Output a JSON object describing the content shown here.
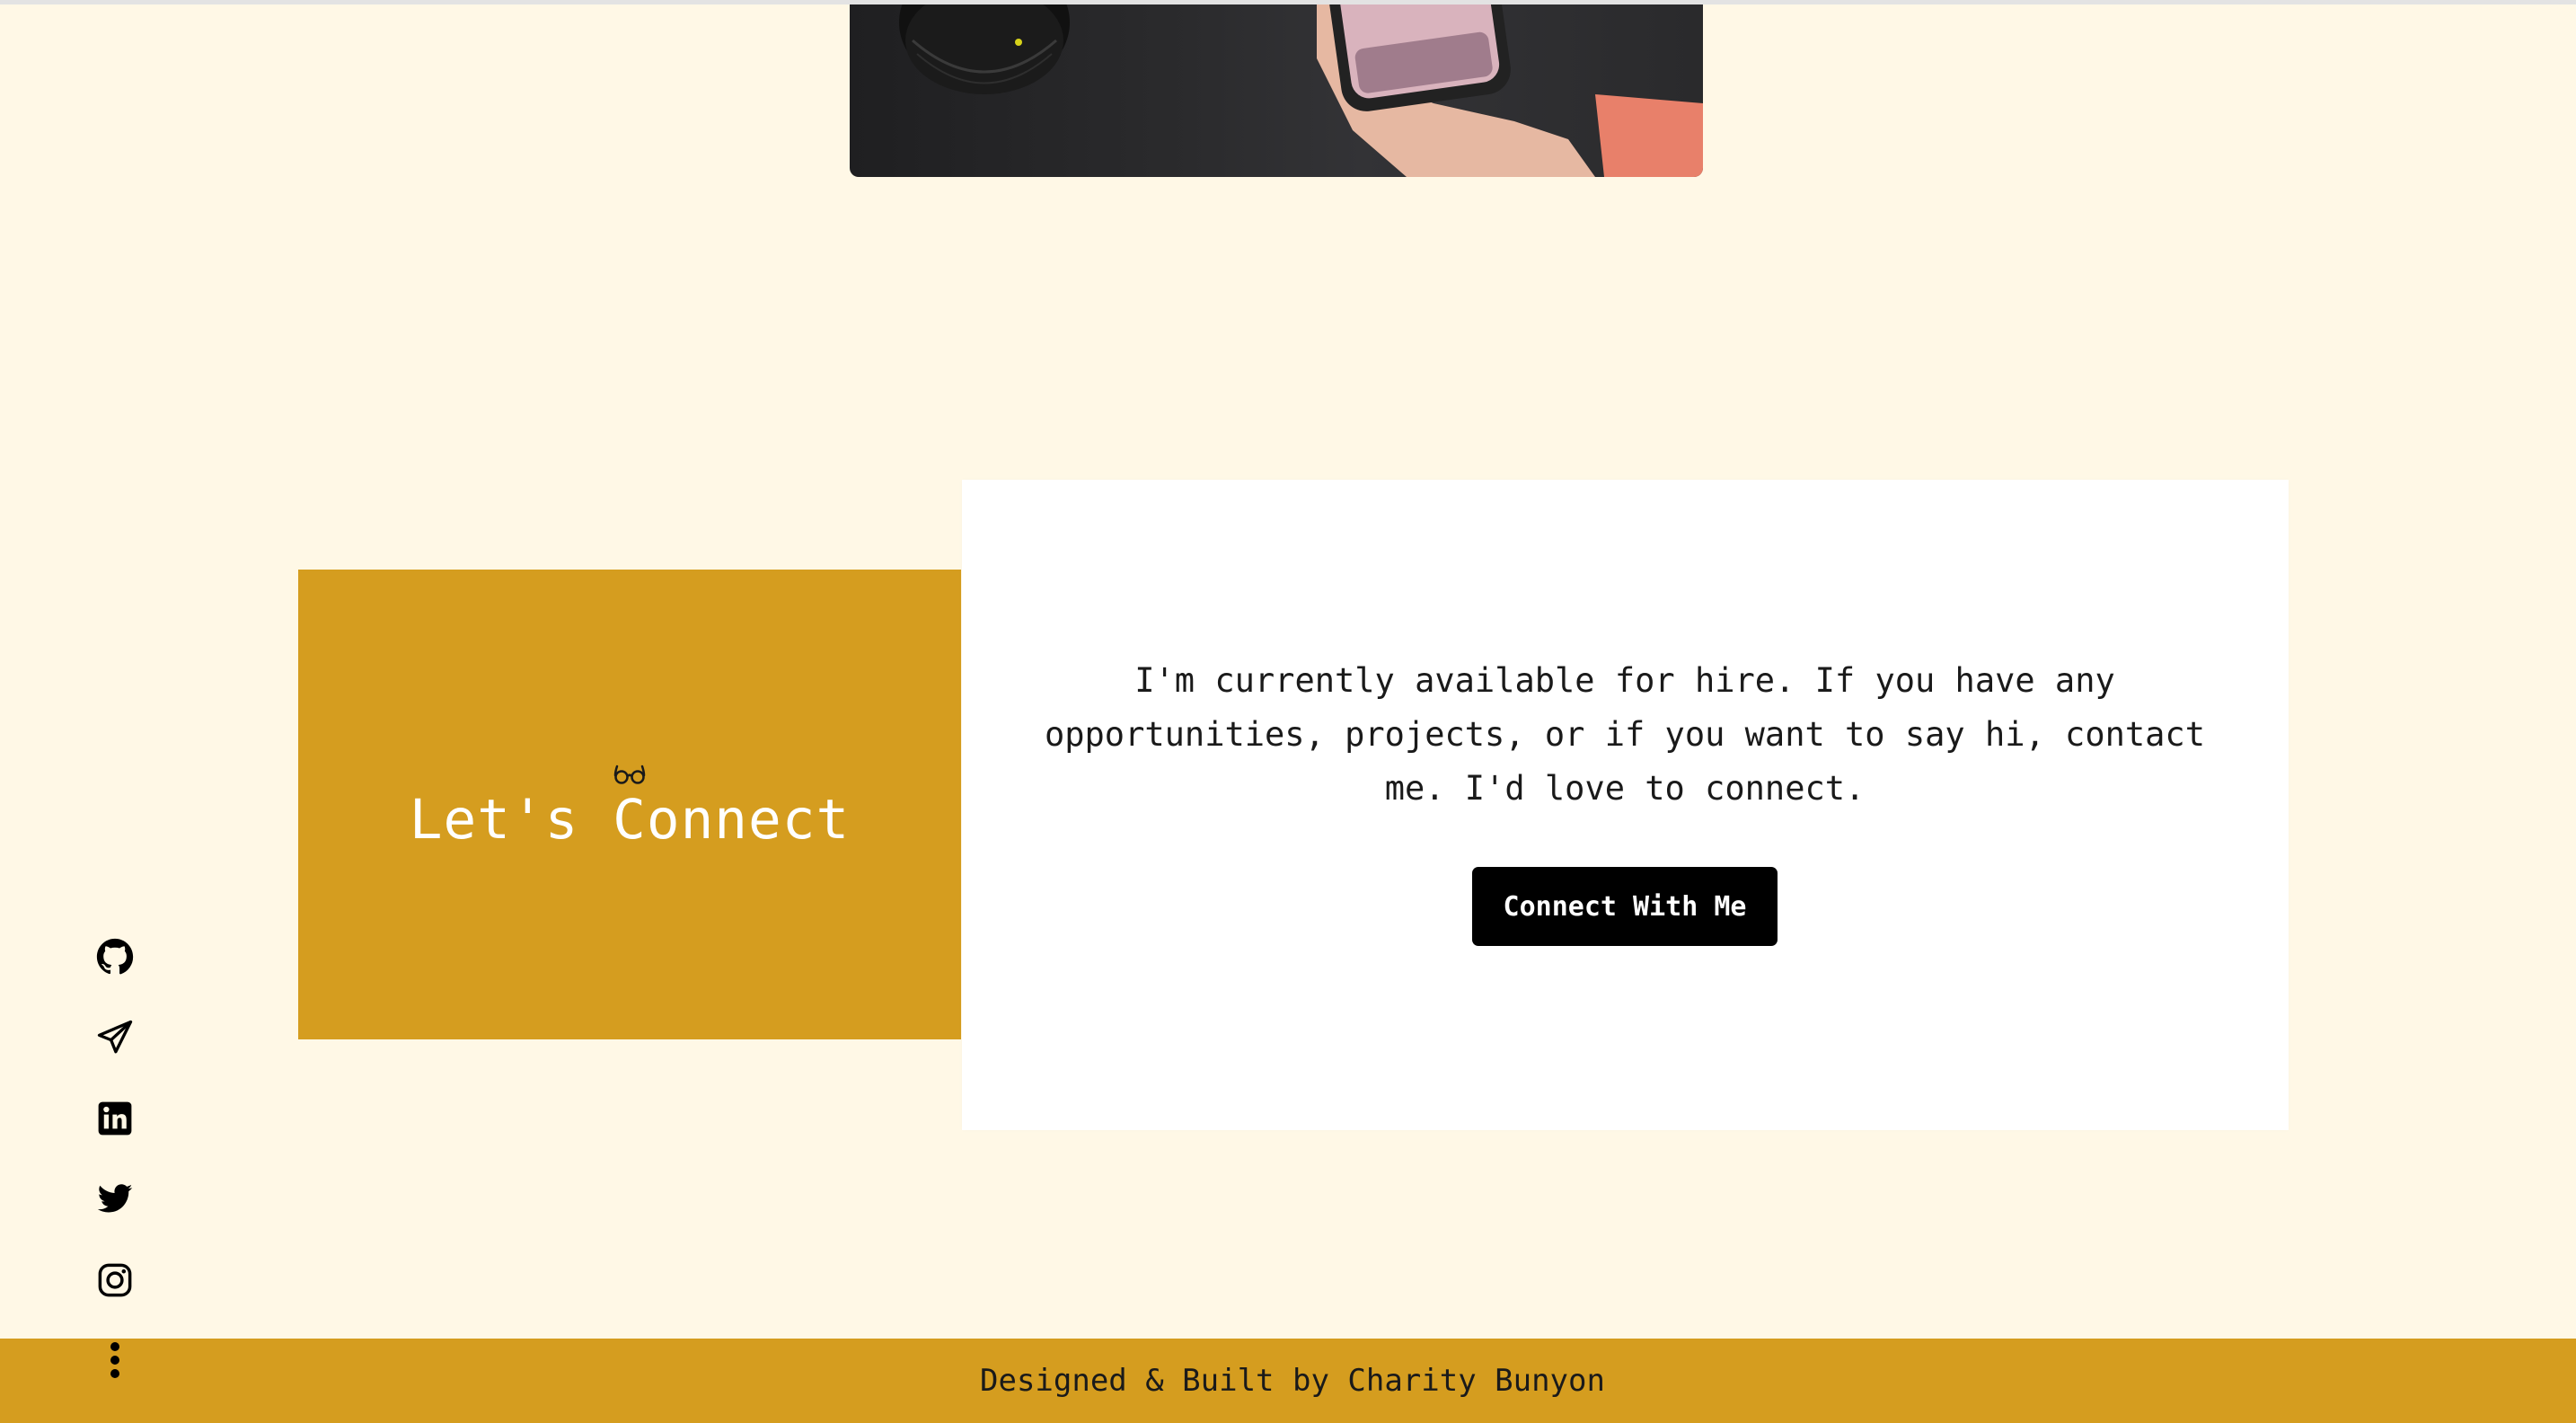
{
  "connect": {
    "title": "Let's Connect",
    "message": "I'm currently available for hire. If you have any opportunities, projects, or if you want to say hi, contact me. I'd love to connect.",
    "button_label": "Connect With Me"
  },
  "social_links": [
    {
      "icon": "github-icon"
    },
    {
      "icon": "paper-plane-icon"
    },
    {
      "icon": "linkedin-icon"
    },
    {
      "icon": "twitter-icon"
    },
    {
      "icon": "instagram-icon"
    },
    {
      "icon": "more-vertical-icon"
    }
  ],
  "footer": {
    "text": "Designed & Built by Charity Bunyon"
  },
  "colors": {
    "page_background": "#fff8e6",
    "accent": "#d59d1f",
    "card": "#ffffff",
    "button": "#000000"
  }
}
